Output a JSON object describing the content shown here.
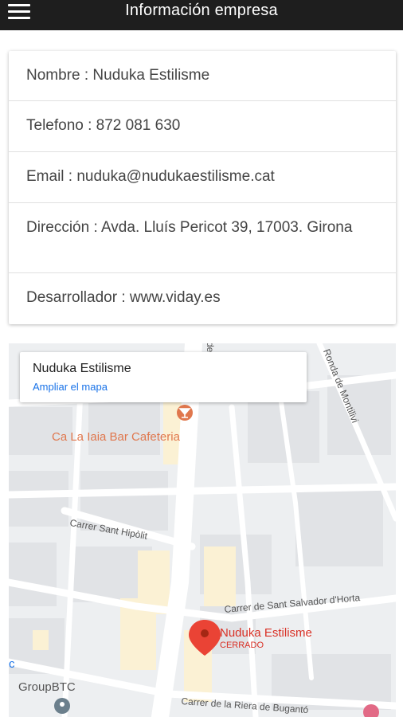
{
  "header": {
    "title": "Información empresa",
    "menu_icon": "hamburger-menu-icon"
  },
  "info": {
    "nombre": "Nombre : Nuduka Estilisme",
    "telefono": "Telefono : 872 081 630",
    "email": "Email : nuduka@nudukaestilisme.cat",
    "direccion": "Dirección : Avda. Lluís Pericot 39, 17003. Girona",
    "desarrollador": "Desarrollador : www.viday.es"
  },
  "map": {
    "card_title": "Nuduka Estilisme",
    "enlarge_link": "Ampliar el mapa",
    "poi_bar": "Ca La Iaia Bar Cafeteria",
    "marker_name": "Nuduka Estilisme",
    "marker_status": "CERRADO",
    "street_hipolit": "Carrer Sant Hipòlit",
    "street_salvador": "Carrer de Sant Salvador d'Horta",
    "street_riera": "Carrer de la Riera de Bugantó",
    "street_montilivi": "Ronda de Montilivi",
    "street_de": "de",
    "poi_group": "GroupBTC",
    "edge_c": "c",
    "colors": {
      "marker": "#ea4335",
      "poi_orange": "#e0774d",
      "link": "#1a73e8"
    }
  }
}
